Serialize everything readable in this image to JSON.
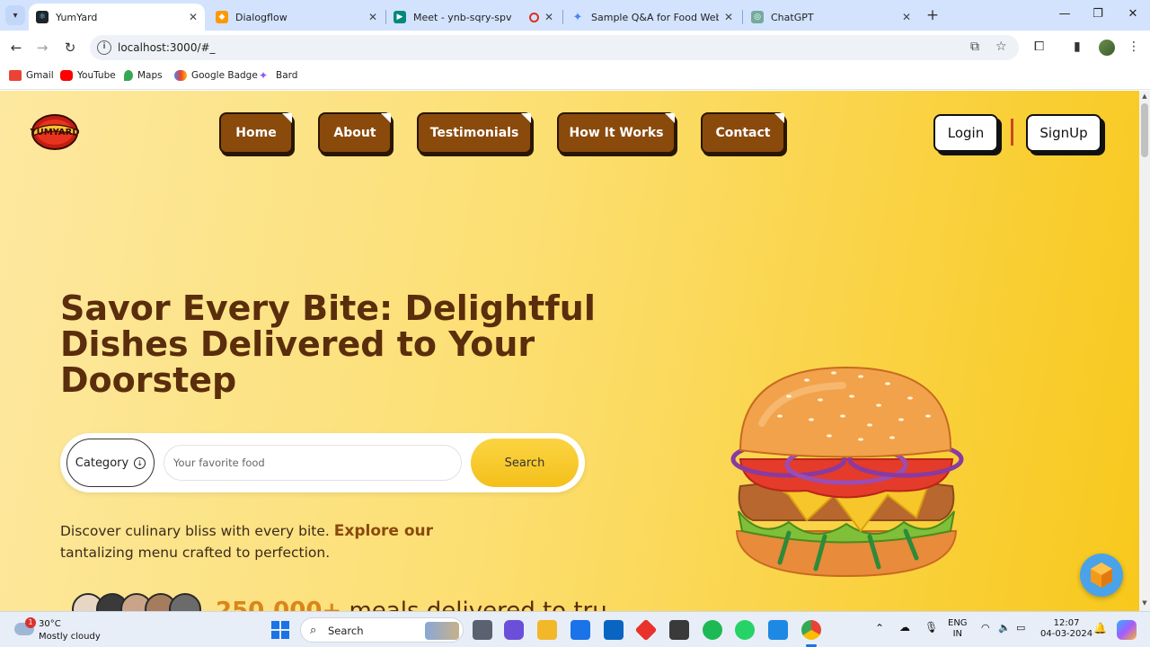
{
  "browser": {
    "tabs": [
      {
        "title": "YumYard",
        "active": true,
        "favicon": "react-icon"
      },
      {
        "title": "Dialogflow",
        "active": false,
        "favicon": "dialogflow-icon"
      },
      {
        "title": "Meet - ynb-sqry-spv",
        "active": false,
        "favicon": "google-meet-icon",
        "recording": true
      },
      {
        "title": "Sample Q&A for Food Website",
        "active": false,
        "favicon": "gemini-icon"
      },
      {
        "title": "ChatGPT",
        "active": false,
        "favicon": "chatgpt-icon"
      }
    ],
    "url": "localhost:3000/#_",
    "bookmarks": [
      {
        "label": "Gmail",
        "icon": "gmail-icon",
        "color": "#ea4335"
      },
      {
        "label": "YouTube",
        "icon": "youtube-icon",
        "color": "#ff0000"
      },
      {
        "label": "Maps",
        "icon": "maps-icon",
        "color": "#34a853"
      },
      {
        "label": "Google Badge",
        "icon": "google-cloud-icon",
        "color": "#4285f4"
      },
      {
        "label": "Bard",
        "icon": "bard-icon",
        "color": "#8a5cf6"
      }
    ]
  },
  "site": {
    "logo_text": "YUMYARD",
    "nav": [
      "Home",
      "About",
      "Testimonials",
      "How It Works",
      "Contact"
    ],
    "auth": {
      "login": "Login",
      "signup": "SignUp"
    },
    "hero_title": "Savor Every Bite: Delightful Dishes Delivered to Your Doorstep",
    "search": {
      "category_label": "Category",
      "placeholder": "Your favorite food",
      "button_label": "Search"
    },
    "tagline": {
      "before": "Discover culinary bliss with every bite. ",
      "highlight": "Explore our",
      "after": " tantalizing menu crafted to perfection."
    },
    "stat": {
      "number": "250,000+",
      "text": " meals delivered to tru"
    },
    "colors": {
      "brand_brown": "#8a4a0c",
      "title_brown": "#5a2d0c",
      "accent_yellow": "#f8c81c"
    }
  },
  "taskbar": {
    "weather_temp": "30°C",
    "weather_desc": "Mostly cloudy",
    "notification_count": "1",
    "search_label": "Search",
    "language_line1": "ENG",
    "language_line2": "IN",
    "time": "12:07",
    "date": "04-03-2024"
  }
}
